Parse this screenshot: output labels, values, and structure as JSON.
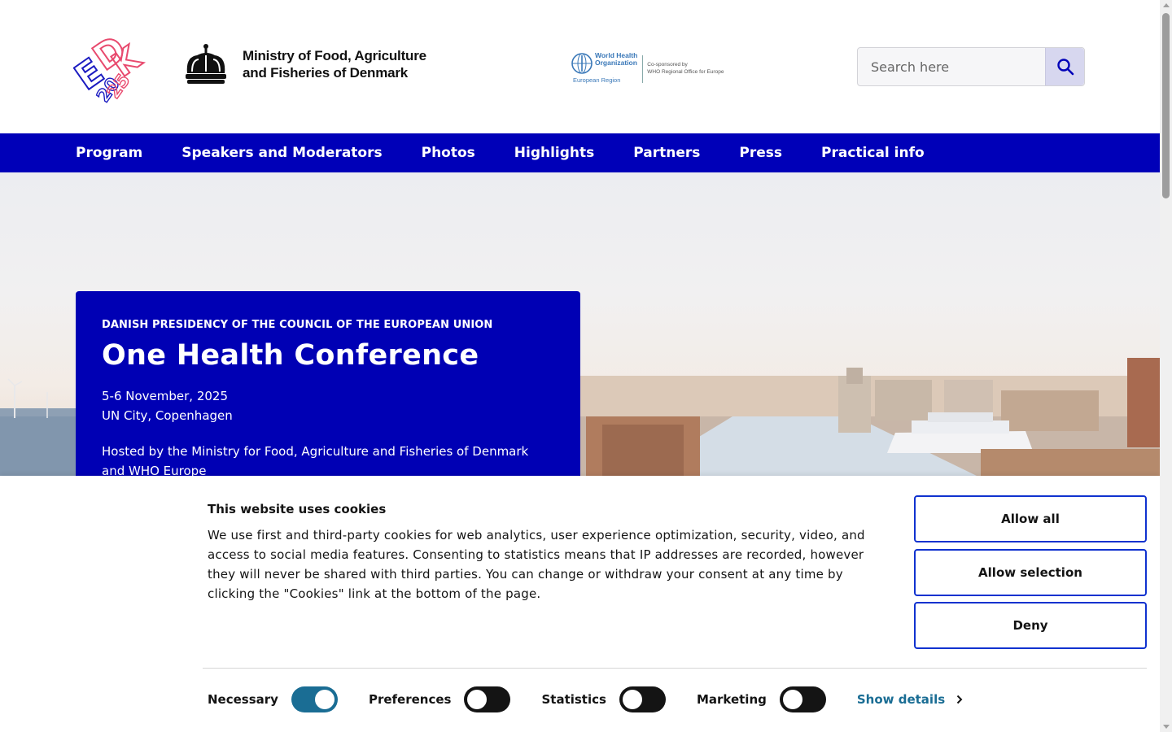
{
  "header": {
    "ministry_line1": "Ministry of Food, Agriculture",
    "ministry_line2": "and Fisheries of Denmark",
    "who_line1": "World Health",
    "who_line2": "Organization",
    "who_region": "European Region",
    "who_cospons_line1": "Co-sponsored by",
    "who_cospons_line2": "WHO Regional Office for Europe",
    "search_placeholder": "Search here"
  },
  "nav": {
    "items": [
      {
        "label": "Program"
      },
      {
        "label": "Speakers and Moderators"
      },
      {
        "label": "Photos"
      },
      {
        "label": "Highlights"
      },
      {
        "label": "Partners"
      },
      {
        "label": "Press"
      },
      {
        "label": "Practical info"
      }
    ]
  },
  "hero": {
    "eyebrow": "DANISH PRESIDENCY OF THE COUNCIL OF THE EUROPEAN UNION",
    "title": "One Health Conference",
    "date": "5-6 November, 2025",
    "location": "UN City, Copenhagen",
    "host": "Hosted by the Ministry for Food, Agriculture and Fisheries of Denmark and WHO Europe"
  },
  "cookie": {
    "title": "This website uses cookies",
    "text": "We use first and third-party cookies for web analytics, user experience optimization, security, video, and access to social media features. Consenting to statistics means that IP addresses are recorded, however they will never be shared with third parties. You can change or withdraw your consent at any time by clicking the \"Cookies\" link at the bottom of the page.",
    "allow_all": "Allow all",
    "allow_selection": "Allow selection",
    "deny": "Deny",
    "toggles": [
      {
        "label": "Necessary",
        "on": true
      },
      {
        "label": "Preferences",
        "on": false
      },
      {
        "label": "Statistics",
        "on": false
      },
      {
        "label": "Marketing",
        "on": false
      }
    ],
    "show_details": "Show details"
  },
  "colors": {
    "brand_blue": "#0000b8",
    "toggle_on": "#1a6d94",
    "button_border": "#1032cf"
  }
}
